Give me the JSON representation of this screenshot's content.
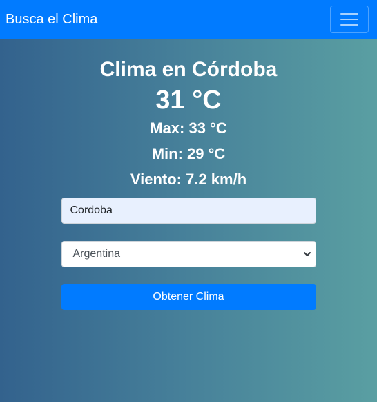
{
  "navbar": {
    "brand": "Busca el Clima"
  },
  "weather": {
    "title": "Clima en Córdoba",
    "temperature": "31 °C",
    "max": "Max: 33 °C",
    "min": "Min: 29 °C",
    "wind": "Viento: 7.2 km/h"
  },
  "form": {
    "city_value": "Cordoba",
    "country_selected": "Argentina",
    "submit_label": "Obtener Clima"
  },
  "icons": {
    "menu": "hamburger-menu-icon",
    "select_arrow": "chevron-down-icon"
  },
  "colors": {
    "navbar": "#017bff",
    "button": "#017bff",
    "gradient_start": "#33628d",
    "gradient_end": "#5a9fa2",
    "input_autofill": "#e8f0fe"
  }
}
